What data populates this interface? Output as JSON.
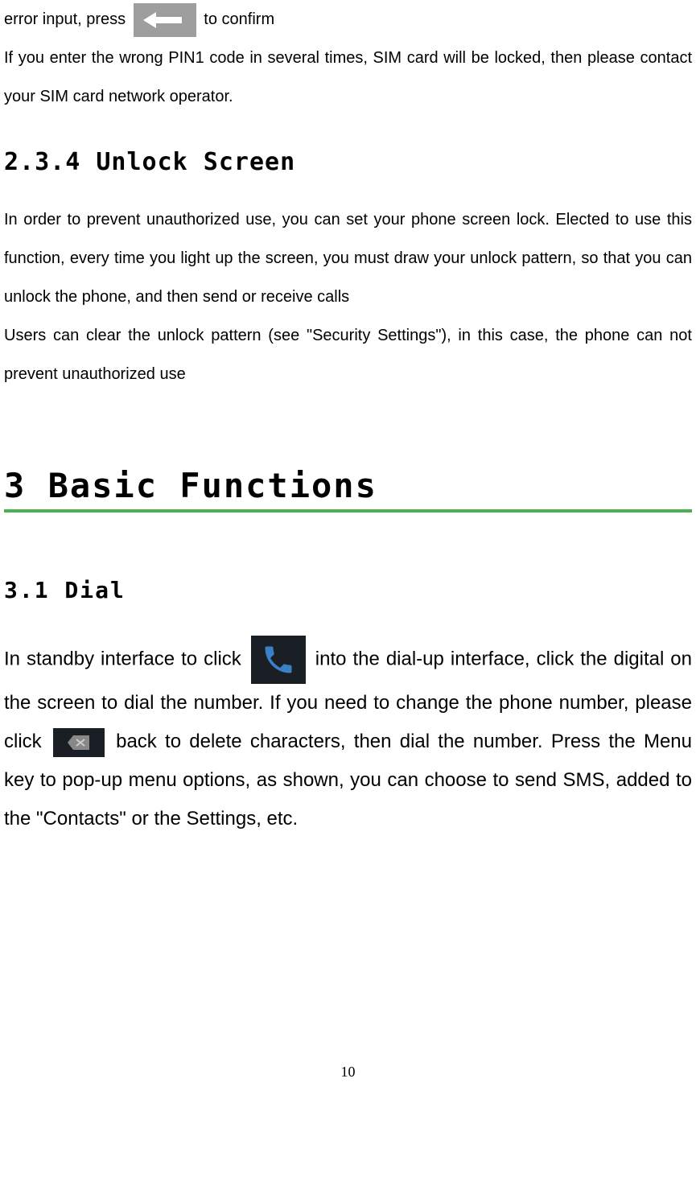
{
  "top": {
    "line1_a": "error input, press ",
    "line1_b": " to confirm",
    "line2": "If you enter the wrong PIN1 code in several times, SIM card will be locked, then please contact your SIM card network operator."
  },
  "h234": "2.3.4  Unlock Screen",
  "section234": {
    "p1": "In order to prevent unauthorized use, you can set your phone screen lock. Elected to use this function, every time you light up the screen, you must draw your unlock pattern, so that you can unlock the phone, and then send or receive calls",
    "p2": "Users can clear the unlock pattern (see \"Security Settings\"), in this case, the phone can not prevent unauthorized use"
  },
  "h3": "3 Basic Functions",
  "h31": "3.1 Dial",
  "section31": {
    "part1": "In standby interface to click ",
    "part2": " into the dial-up interface, click the digital on the screen to dial the number. If you need to change the phone number, please click ",
    "part3": " back to delete characters, then dial the number. Press the Menu key to pop-up menu options, as shown, you can choose to send SMS, added to the \"Contacts\" or the Settings, etc."
  },
  "pageNumber": "10"
}
